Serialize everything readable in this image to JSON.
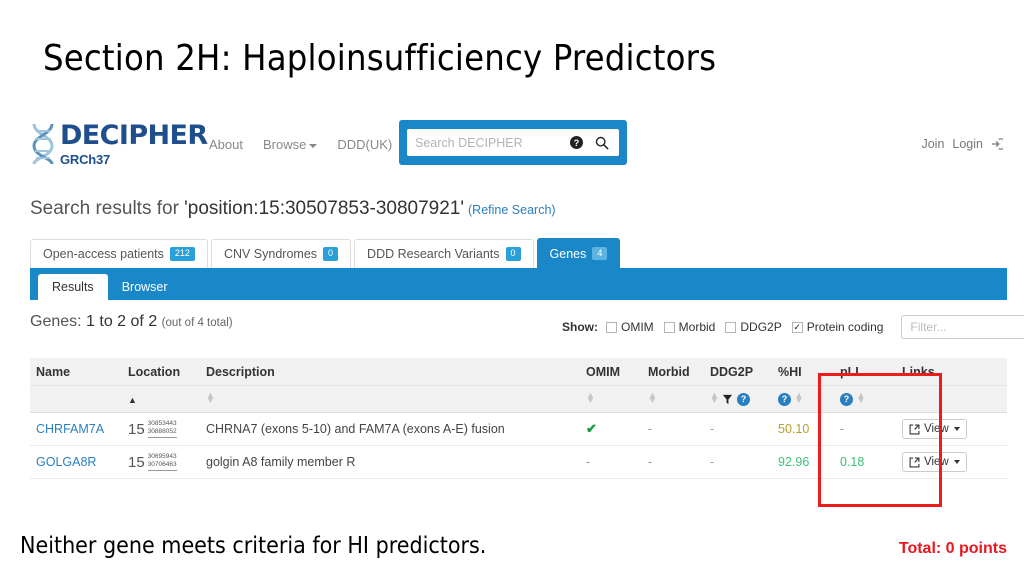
{
  "slide": {
    "title": "Section 2H: Haploinsufficiency Predictors",
    "caption": "Neither gene meets criteria for HI predictors.",
    "total": "Total: 0 points"
  },
  "header": {
    "logo_main": "DECIPHER",
    "logo_sub": "GRCh37",
    "nav": [
      {
        "label": "About",
        "caret": false
      },
      {
        "label": "Browse",
        "caret": true
      },
      {
        "label": "DDD(UK)",
        "caret": false
      }
    ],
    "search": {
      "placeholder": "Search DECIPHER",
      "value": "",
      "help_glyph": "?"
    },
    "account": {
      "join": "Join",
      "login": "Login"
    }
  },
  "results": {
    "prefix": "Search results for ",
    "query": "'position:15:30507853-30807921'",
    "refine": "(Refine Search)"
  },
  "tabs": [
    {
      "label": "Open-access patients",
      "count": "212",
      "active": false
    },
    {
      "label": "CNV Syndromes",
      "count": "0",
      "active": false
    },
    {
      "label": "DDD Research Variants",
      "count": "0",
      "active": false
    },
    {
      "label": "Genes",
      "count": "4",
      "active": true
    }
  ],
  "subtabs": [
    {
      "label": "Results",
      "active": true
    },
    {
      "label": "Browser",
      "active": false
    }
  ],
  "summary": {
    "label": "Genes:",
    "range": "1 to 2 of 2",
    "total": "(out of 4 total)"
  },
  "show": {
    "label": "Show:",
    "options": [
      {
        "label": "OMIM",
        "checked": false
      },
      {
        "label": "Morbid",
        "checked": false
      },
      {
        "label": "DDG2P",
        "checked": false
      },
      {
        "label": "Protein coding",
        "checked": true
      }
    ],
    "filter_placeholder": "Filter...",
    "filter_value": ""
  },
  "table": {
    "columns": [
      "Name",
      "Location",
      "Description",
      "OMIM",
      "Morbid",
      "DDG2P",
      "%HI",
      "pLI",
      "Links"
    ],
    "rows": [
      {
        "name": "CHRFAM7A",
        "chromosome": "15",
        "start": "30853443",
        "end": "30888052",
        "description": "CHRNA7 (exons 5-10) and FAM7A (exons A-E) fusion",
        "omim": "✔",
        "morbid": "-",
        "ddg2p": "-",
        "hi": "50.10",
        "pli": "-",
        "link_label": "View"
      },
      {
        "name": "GOLGA8R",
        "chromosome": "15",
        "start": "30695943",
        "end": "30706463",
        "description": "golgin A8 family member R",
        "omim": "-",
        "morbid": "-",
        "ddg2p": "-",
        "hi": "92.96",
        "pli": "0.18",
        "link_label": "View"
      }
    ]
  },
  "colors": {
    "brand_blue": "#1a87c8",
    "logo_navy": "#1f4e8c",
    "link_blue": "#2a7fc0",
    "highlight_red": "#ee1c1c",
    "hi_olive": "#b3a12a",
    "hi_green": "#3cc27a",
    "check_green": "#1a9b3c"
  }
}
